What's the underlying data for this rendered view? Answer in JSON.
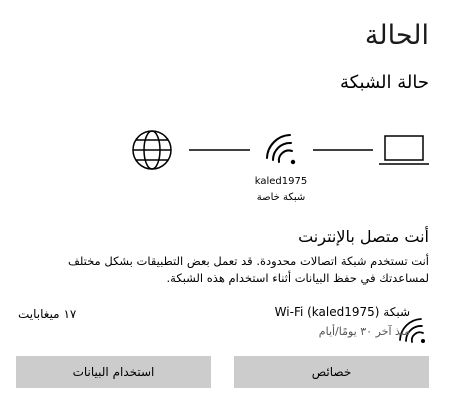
{
  "page": {
    "title": "الحالة"
  },
  "network_status": {
    "section_title": "حالة الشبكة",
    "diagram": {
      "connection_name": "kaled1975",
      "connection_type": "شبكة خاصة"
    },
    "status_heading": "أنت متصل بالإنترنت",
    "status_description": "أنت تستخدم شبكة اتصالات محدودة. قد تعمل بعض التطبيقات بشكل مختلف لمساعدتك في حفظ البيانات أثناء استخدام هذه الشبكة."
  },
  "connection": {
    "icon": "wifi-icon",
    "name": "شبكة (Wi-Fi (kaled1975",
    "period": "منذ آخر ٣٠ يومًا/أيام",
    "data_used": "١٧ ميغابايت"
  },
  "buttons": {
    "properties": "خصائص",
    "data_usage": "استخدام البيانات"
  },
  "colors": {
    "button_bg": "#cccccc",
    "text": "#000000"
  }
}
